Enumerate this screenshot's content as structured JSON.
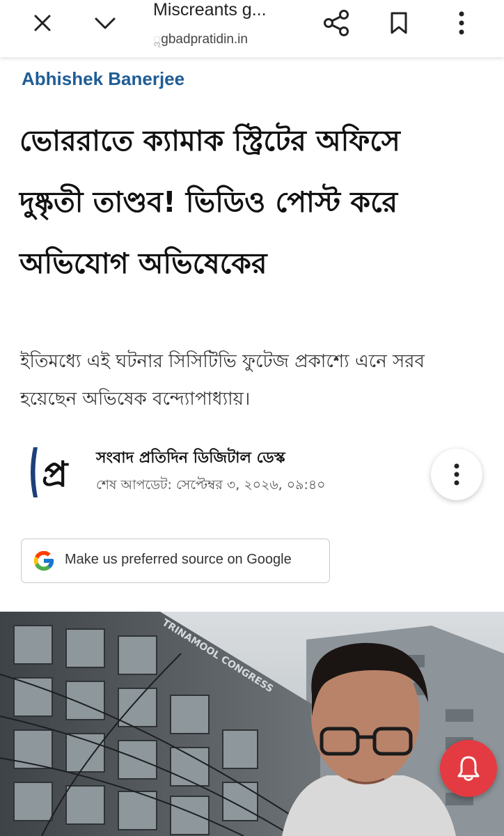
{
  "browser": {
    "title": "Miscreants g...",
    "url_faded": "ॢ",
    "url": "gbadpratidin.in"
  },
  "article": {
    "author": "Abhishek Banerjee",
    "headline": "ভোররাতে ক্যামাক স্ট্রিটের অফিসে দুষ্কৃতী তাণ্ডব! ভিডিও পোস্ট করে অভিযোগ অভিষেকের",
    "subheadline": "ইতিমধ্যে এই ঘটনার সিসিটিভি ফুটেজ প্রকাশ্যে এনে সরব হয়েছেন অভিষেক বন্দ্যোপাধ্যায়।"
  },
  "byline": {
    "logo_text": "প্র",
    "desk": "সংবাদ প্রতিদিন ডিজিটাল ডেস্ক",
    "updated": "শেষ আপডেট: সেপ্টেম্বর ৩, ২০২৬, ০৯:৪০"
  },
  "google_pref": {
    "label": "Make us preferred source on Google"
  },
  "hero_image": {
    "sign_text": "TRINAMOOL CONGRESS"
  },
  "icons": {
    "close": "close-icon",
    "collapse": "chevron-down-icon",
    "share": "share-icon",
    "bookmark": "bookmark-icon",
    "menu": "more-vert-icon",
    "notify": "bell-icon"
  },
  "colors": {
    "author": "#1f5d96",
    "bell_button": "#e33b41",
    "logo_blue": "#1e3f7a"
  }
}
